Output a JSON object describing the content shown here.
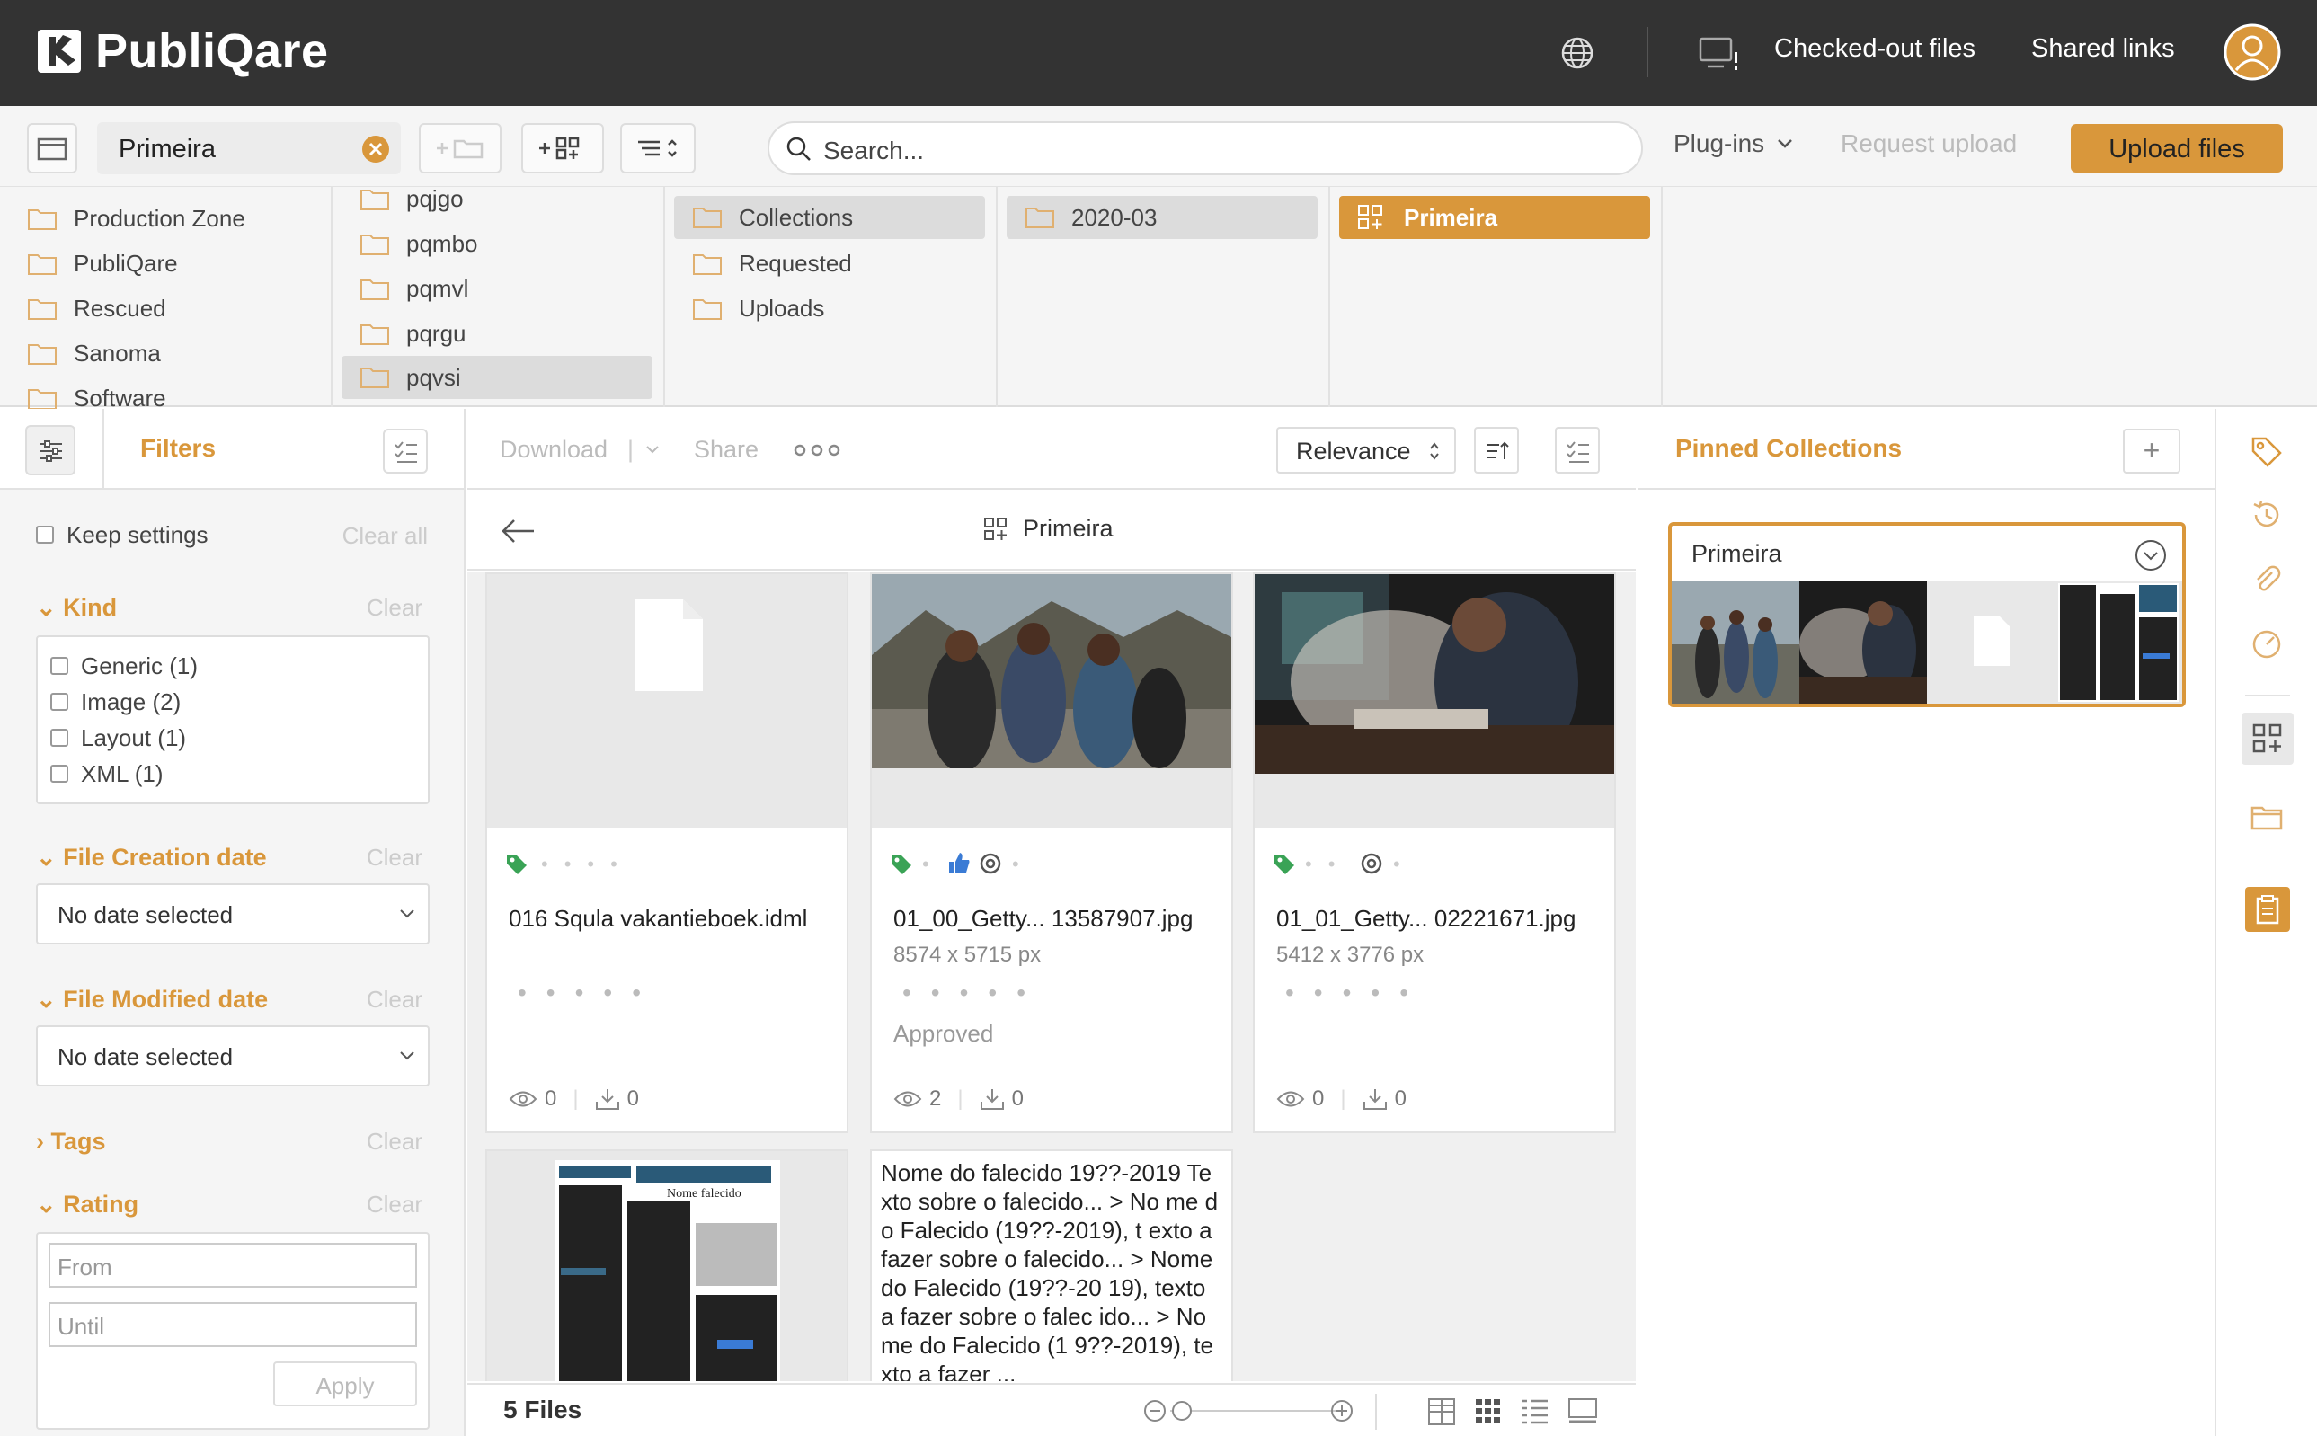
{
  "app": {
    "name": "PubliQare"
  },
  "header": {
    "checked_out": "Checked-out files",
    "shared_links": "Shared links"
  },
  "toolbar": {
    "collection_pill": "Primeira",
    "search_placeholder": "Search...",
    "plugins": "Plug-ins",
    "request_upload": "Request upload",
    "upload_files": "Upload files",
    "accent": "#d9973b"
  },
  "browser": {
    "col1": [
      "Production Zone",
      "PubliQare",
      "Rescued",
      "Sanoma",
      "Software"
    ],
    "col2": [
      "pqjgo",
      "pqmbo",
      "pqmvl",
      "pqrgu",
      "pqvsi"
    ],
    "col2_selected": "pqvsi",
    "col3": [
      "Collections",
      "Requested",
      "Uploads"
    ],
    "col3_selected": "Collections",
    "col4": [
      "2020-03"
    ],
    "col5": [
      "Primeira"
    ]
  },
  "filters": {
    "title": "Filters",
    "keep_settings": "Keep settings",
    "clear_all": "Clear all",
    "clear": "Clear",
    "kind": {
      "label": "Kind",
      "options": [
        "Generic (1)",
        "Image (2)",
        "Layout (1)",
        "XML (1)"
      ]
    },
    "creation": {
      "label": "File Creation date",
      "value": "No date selected"
    },
    "modified": {
      "label": "File Modified date",
      "value": "No date selected"
    },
    "tags": {
      "label": "Tags"
    },
    "rating": {
      "label": "Rating",
      "from": "From",
      "until": "Until",
      "apply": "Apply"
    }
  },
  "results": {
    "download": "Download",
    "share": "Share",
    "sort": "Relevance",
    "breadcrumb": "Primeira",
    "count": "5 Files",
    "cards": [
      {
        "name": "016 Squla vakantieboek.idml",
        "dims": "",
        "status": "",
        "views": "0",
        "downloads": "0"
      },
      {
        "name": "01_00_Getty... 13587907.jpg",
        "dims": "8574 x 5715 px",
        "status": "Approved",
        "views": "2",
        "downloads": "0"
      },
      {
        "name": "01_01_Getty... 02221671.jpg",
        "dims": "5412 x 3776 px",
        "status": "",
        "views": "0",
        "downloads": "0"
      }
    ],
    "text_preview": "Nome do falecido 19??-2019 Texto sobre o falecido... > No me do Falecido (19??-2019), t exto a fazer sobre o falecido... > Nome do Falecido (19??-20 19), texto a fazer sobre o falec ido... > Nome do Falecido (1 9??-2019), texto a fazer ...",
    "doc_thumb_label": "Nome falecido"
  },
  "pinned": {
    "title": "Pinned Collections",
    "collection_name": "Primeira"
  }
}
